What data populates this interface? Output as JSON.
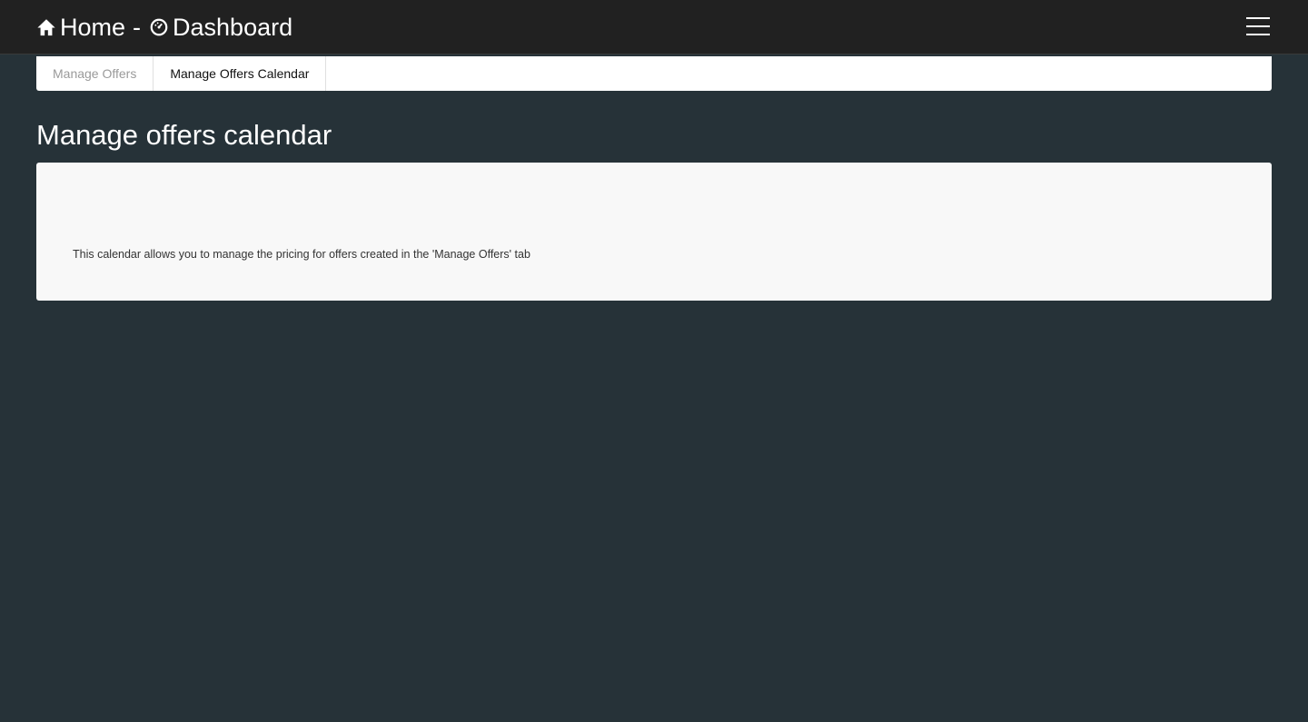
{
  "header": {
    "home_label": "Home",
    "separator": "-",
    "dashboard_label": "Dashboard",
    "home_icon": "home-icon",
    "dashboard_icon": "dashboard-icon",
    "menu_icon": "hamburger-menu-icon",
    "background_color": "#212121"
  },
  "tabs": [
    {
      "label": "Manage Offers",
      "active": false
    },
    {
      "label": "Manage Offers Calendar",
      "active": true
    }
  ],
  "main": {
    "title": "Manage offers calendar",
    "description": "This calendar allows you to manage the pricing for offers created in the 'Manage Offers' tab",
    "background_color": "#263238"
  }
}
